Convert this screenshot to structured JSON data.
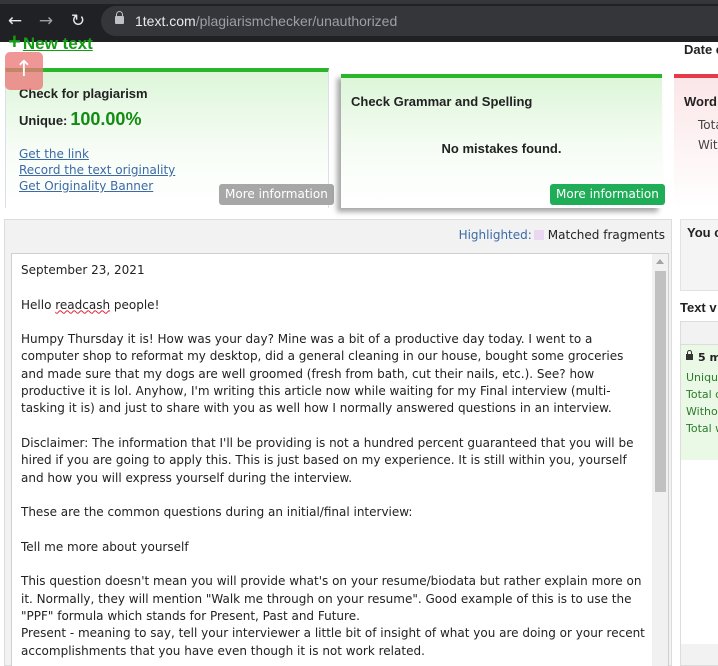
{
  "browser": {
    "url_host": "1text.com",
    "url_path": "/plagiarismchecker/unauthorized"
  },
  "header": {
    "new_text": "New text",
    "date_label": "Date c"
  },
  "cards": {
    "plagiarism": {
      "title": "Check for plagiarism",
      "unique_label": "Unique:",
      "unique_value": "100.00%",
      "links": [
        "Get the link",
        "Record the text originality",
        "Get Originality Banner"
      ],
      "button": "More information"
    },
    "grammar": {
      "title": "Check Grammar and Spelling",
      "result": "No mistakes found.",
      "button": "More information"
    },
    "words": {
      "title": "Word",
      "lines": [
        "Tota",
        "Wit"
      ]
    }
  },
  "main": {
    "highlighted_label": "Highlighted:",
    "matched_label": "Matched fragments",
    "paragraphs": {
      "date": "September 23, 2021",
      "greeting_pre": "Hello ",
      "greeting_word": "readcash",
      "greeting_post": " people!",
      "p1": "Humpy Thursday it is! How was your day? Mine was a bit of a productive day today. I went to a computer shop to reformat my desktop, did a general cleaning in our house, bought some groceries and made sure that my dogs are well groomed (fresh from bath, cut their nails, etc.). See? how productive it is lol. Anyhow, I'm writing this article now while waiting for my Final interview (multi-tasking it is) and just to share with you as well how I normally answered questions in an interview.",
      "p2": "Disclaimer: The information that I'll be providing is not a hundred percent guaranteed that you will be hired if you are going to apply this. This is just based on my experience. It is still within you, yourself and how you will express yourself during the interview.",
      "p3": "These are the common questions during an initial/final interview:",
      "p4": "Tell me more about yourself",
      "p5": "This question doesn't mean you will provide what's on your resume/biodata but rather explain more on it. Normally, they will mention \"Walk me through on your resume\". Good example of this is to use the \"PPF\" formula which stands for Present, Past and Future.",
      "p6": "Present - meaning to say, tell your interviewer a little bit of insight of what you are doing or your recent accomplishments that you have even though it is not work related."
    }
  },
  "right": {
    "box_title": "You c",
    "text_v": "Text v",
    "five": "5 m",
    "lines": [
      "Unique",
      "Total c",
      "Withou",
      "Total w"
    ]
  },
  "colors": {
    "green": "#2bb52b",
    "red": "#e63a4c",
    "link": "#3a6aa8",
    "highlight": "#ead8f3"
  }
}
